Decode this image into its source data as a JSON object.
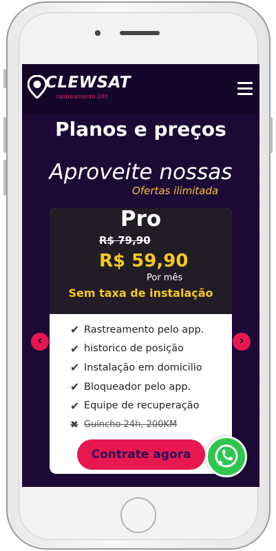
{
  "brand": {
    "name": "CLEWSAT",
    "tagline": "rastreamento 24h",
    "accent_color": "#e8174f",
    "price_color": "#f7c91f"
  },
  "header": {
    "menu_icon": "hamburger-menu-icon"
  },
  "page": {
    "title": "Planos e preços",
    "promo_title": "Aproveite nossas",
    "promo_subtitle": "Ofertas ilimitada"
  },
  "plan": {
    "name": "Pro",
    "old_price": "R$ 79,90",
    "price": "R$ 59,90",
    "period": "Por mês",
    "installation": "Sem taxa de instalação",
    "features": [
      {
        "label": "Rastreamento pelo app.",
        "included": true
      },
      {
        "label": "historico de posição",
        "included": true
      },
      {
        "label": "Instalação em domicilio",
        "included": true
      },
      {
        "label": "Bloqueador pelo app.",
        "included": true
      },
      {
        "label": "Equipe de recuperação",
        "included": true
      },
      {
        "label": "Guincho 24h, 200KM",
        "included": false
      }
    ],
    "cta_label": "Contrate agora"
  },
  "carousel": {
    "prev_icon": "chevron-left-icon",
    "next_icon": "chevron-right-icon"
  },
  "floating": {
    "whatsapp_icon": "whatsapp-icon"
  }
}
